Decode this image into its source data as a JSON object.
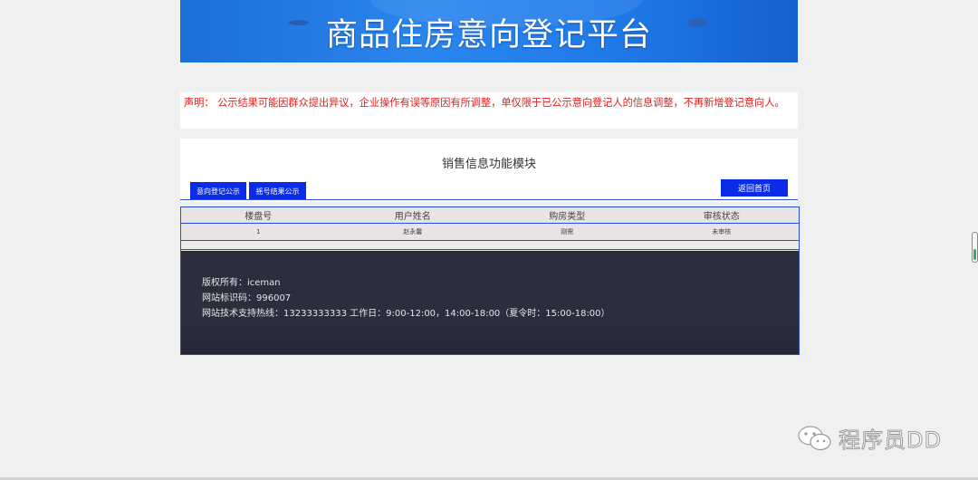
{
  "banner": {
    "title": "商品住房意向登记平台"
  },
  "notice": {
    "text": "声明： 公示结果可能因群众提出异议，企业操作有误等原因有所调整，单仅限于已公示意向登记人的信息调整，不再新增登记意向人。"
  },
  "module": {
    "title": "销售信息功能模块",
    "tabs": [
      {
        "label": "意向登记公示"
      },
      {
        "label": "摇号结果公示"
      }
    ],
    "home_button": "返回首页"
  },
  "table": {
    "headers": [
      "楼盘号",
      "用户姓名",
      "购房类型",
      "审核状态"
    ],
    "rows": [
      [
        "1",
        "赵永馨",
        "刚需",
        "未审核"
      ]
    ]
  },
  "footer": {
    "copyright": "版权所有：iceman",
    "site_id": "网站标识码：996007",
    "hotline": "网站技术支持热线：13233333333  工作日：9:00-12:00，14:00-18:00（夏令时：15:00-18:00）"
  },
  "watermark": {
    "text": "程序员DD",
    "icon": "wechat-icon"
  },
  "colors": {
    "accent": "#0a2ce6",
    "notice_red": "#e02020",
    "footer_bg": "#2a2c3b"
  }
}
